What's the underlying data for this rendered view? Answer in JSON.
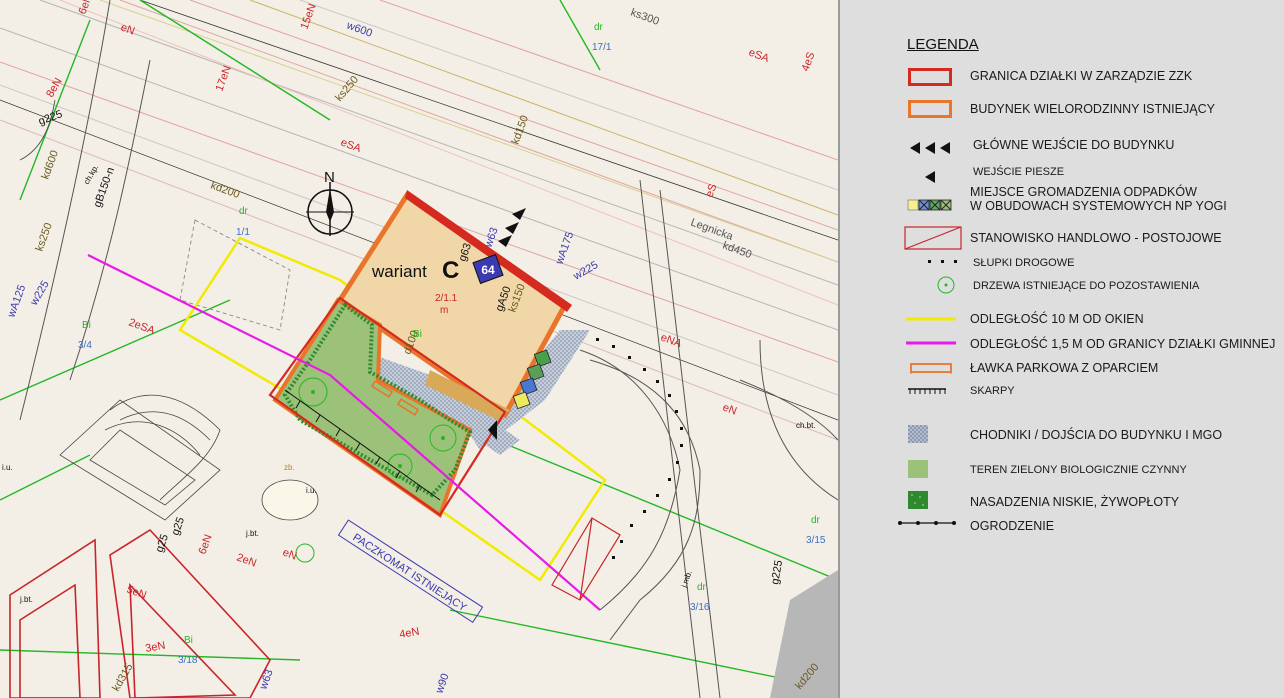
{
  "map": {
    "variant_label": "wariant",
    "variant_letter": "C",
    "building_number": "64",
    "parcel_label_top": "2/1.1",
    "parcel_label_bottom": "m",
    "north_letter": "N",
    "parcel_id": "Bi",
    "street_name": "Legnicka",
    "parcel_numbers": [
      "1/1",
      "3/4",
      "17/1",
      "3/15",
      "3/16",
      "3/18"
    ],
    "parcel_tags": [
      "dr",
      "Bi",
      "dr",
      "dr",
      "dr",
      "Bi"
    ],
    "utility_labels": [
      "eN",
      "eSA",
      "eNA",
      "ks250",
      "ks300",
      "w600",
      "g225",
      "kd200",
      "kd150",
      "kd600",
      "gB150-n",
      "wA175",
      "w225",
      "kd450",
      "w63",
      "g63",
      "gA50",
      "ks150",
      "d100",
      "ks250",
      "wA125",
      "w225",
      "2eSA",
      "17eN",
      "15eN",
      "6eN",
      "4eS",
      "eS",
      "4eN",
      "3eN",
      "5eN",
      "6eN",
      "2eN",
      "g25",
      "g25",
      "kd315",
      "w63",
      "w90",
      "kd200",
      "g225",
      "8eN",
      "eSA",
      "eN",
      "eN"
    ],
    "point_labels": [
      "j.bt.",
      "i.u.",
      "i.u.",
      "zb.",
      "j.bt.",
      "ch.kp.",
      "ch.bt.",
      "j.mb."
    ],
    "paczkomat_label": "PACZKOMAT ISTNIEJĄCY",
    "colors": {
      "parcel_border": "#d42a1f",
      "building": "#e8752a",
      "building_fill": "#f1d6a8",
      "green_area": "#9cc27a",
      "hedge": "#2f8a2f",
      "sidewalk": "#b4bed0",
      "yellow_line": "#f2ea00",
      "magenta_line": "#e81ae8",
      "map_bg": "#f3efe6",
      "green_line": "#23b823"
    }
  },
  "legend": {
    "title": "LEGENDA",
    "items": [
      {
        "label": "GRANICA DZIAŁKI W ZARZĄDZIE ZZK",
        "symbol": "red-border-box-icon"
      },
      {
        "label": "BUDYNEK WIELORODZINNY ISTNIEJĄCY",
        "symbol": "orange-border-box-icon"
      },
      {
        "label": "GŁÓWNE WEJŚCIE DO BUDYNKU",
        "symbol": "triple-triangle-icon"
      },
      {
        "label": "WEJŚCIE PIESZE",
        "symbol": "single-triangle-icon"
      },
      {
        "label": "MIEJSCE GROMADZENIA ODPADKÓW",
        "label2": "W OBUDOWACH SYSTEMOWYCH NP YOGI",
        "symbol": "waste-bins-icon"
      },
      {
        "label": "STANOWISKO HANDLOWO - POSTOJOWE",
        "symbol": "red-diagonal-box-icon"
      },
      {
        "label": "SŁUPKI DROGOWE",
        "symbol": "bollards-icon"
      },
      {
        "label": "DRZEWA ISTNIEJĄCE DO POZOSTAWIENIA",
        "symbol": "tree-circle-icon"
      },
      {
        "label": "ODLEGŁOŚĆ 10 M OD OKIEN",
        "symbol": "yellow-line-icon"
      },
      {
        "label": "ODLEGŁOŚĆ 1,5 M OD GRANICY DZIAŁKI GMINNEJ",
        "symbol": "magenta-line-icon"
      },
      {
        "label": "ŁAWKA PARKOWA Z OPARCIEM",
        "symbol": "bench-icon"
      },
      {
        "label": "SKARPY",
        "symbol": "slope-icon"
      },
      {
        "label": "CHODNIKI / DOJŚCIA DO BUDYNKU I MGO",
        "symbol": "sidewalk-swatch-icon"
      },
      {
        "label": "TEREN ZIELONY BIOLOGICZNIE CZYNNY",
        "symbol": "green-swatch-icon"
      },
      {
        "label": "NASADZENIA NISKIE, ŻYWOPŁOTY",
        "symbol": "hedge-swatch-icon"
      },
      {
        "label": "OGRODZENIE",
        "symbol": "fence-line-icon"
      }
    ]
  }
}
